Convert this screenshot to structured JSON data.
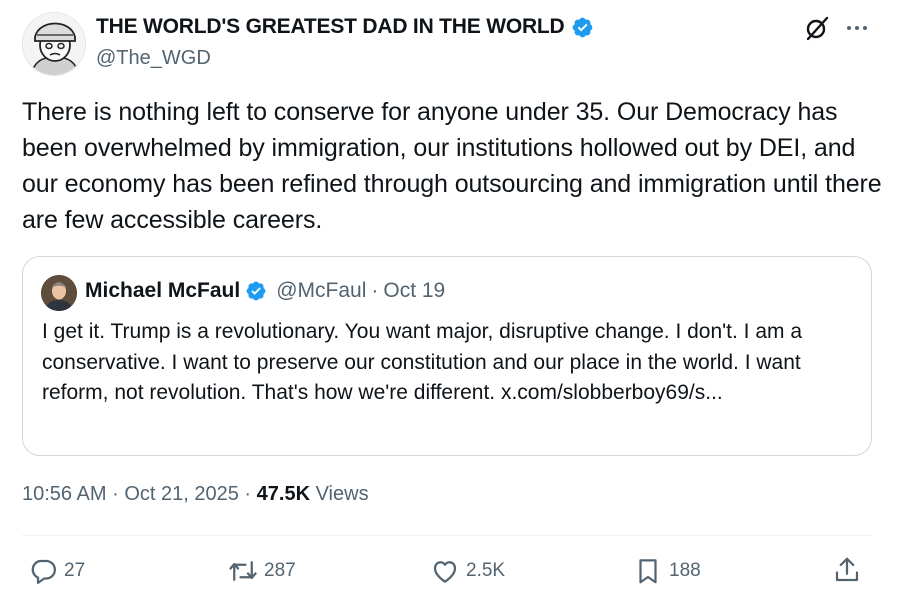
{
  "author": {
    "display_name": "THE WORLD'S GREATEST DAD IN THE WORLD",
    "handle": "@The_WGD",
    "verified": true
  },
  "tweet": {
    "text": "There is nothing left to conserve for anyone under 35. Our Democracy has been overwhelmed by immigration, our institutions hollowed out by DEI, and our economy has been refined through outsourcing and immigration until there are few accessible careers."
  },
  "quote": {
    "display_name": "Michael McFaul",
    "handle": "@McFaul",
    "separator": "·",
    "date": "Oct 19",
    "verified": true,
    "text": "I get it. Trump is a revolutionary. You want major, disruptive change. I don't. I am a conservative. I want to preserve our constitution and our place in the world. I want reform, not revolution. That's how we're different. x.com/slobberboy69/s..."
  },
  "meta": {
    "time": "10:56 AM",
    "separator": "·",
    "date": "Oct 21, 2025",
    "views_count": "47.5K",
    "views_label": "Views"
  },
  "actions": {
    "replies": "27",
    "reposts": "287",
    "likes": "2.5K",
    "bookmarks": "188"
  },
  "colors": {
    "verified": "#1d9bf0",
    "secondary_text": "#536471",
    "border": "#cfd9de"
  },
  "icons": [
    "verified-badge-icon",
    "grok-icon",
    "more-icon",
    "reply-icon",
    "repost-icon",
    "like-icon",
    "bookmark-icon",
    "share-icon"
  ]
}
